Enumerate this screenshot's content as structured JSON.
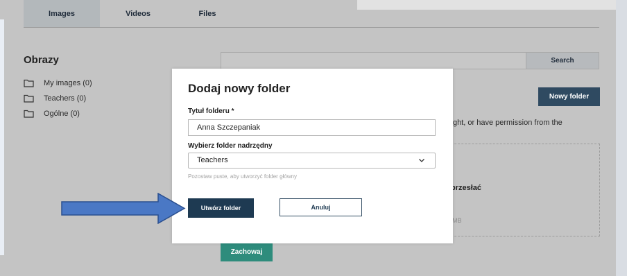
{
  "tabs": [
    {
      "label": "Images"
    },
    {
      "label": "Videos"
    },
    {
      "label": "Files"
    }
  ],
  "sidebar": {
    "title": "Obrazy",
    "folders": [
      {
        "label": "My images (0)",
        "icon": "folder-icon"
      },
      {
        "label": "Teachers (0)",
        "icon": "folder-icon"
      },
      {
        "label": "Ogólne (0)",
        "icon": "folder-icon"
      }
    ]
  },
  "search": {
    "placeholder": "",
    "button_label": "Search"
  },
  "new_folder_button": "Nowy folder",
  "permission_text": "ght, or have permission from the",
  "upload": {
    "partial_label": "przesłać",
    "size_hint": "MB"
  },
  "save_button": "Zachowaj",
  "modal": {
    "title": "Dodaj nowy folder",
    "folder_title_label": "Tytuł folderu *",
    "folder_title_value": "Anna Szczepaniak",
    "parent_label": "Wybierz folder nadrzędny",
    "parent_value": "Teachers",
    "parent_hint": "Pozostaw puste, aby utworzyć folder główny",
    "create_button": "Utwórz folder",
    "cancel_button": "Anuluj"
  },
  "colors": {
    "overlay_bg": "#c4c4c4",
    "primary_dark": "#1e3a52",
    "save_green": "#2e8c7c",
    "arrow_blue": "#4a78c5"
  }
}
